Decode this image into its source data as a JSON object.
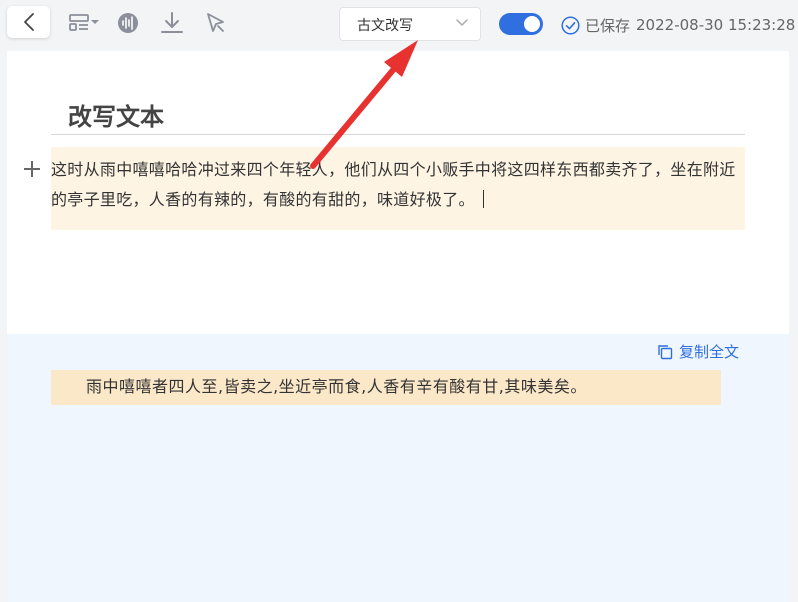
{
  "toolbar": {
    "back_icon": "chevron-left-icon",
    "tools": [
      "layout-menu-icon",
      "audio-wave-icon",
      "download-icon",
      "pointer-cursor-icon"
    ],
    "mode_select": {
      "value": "古文改写"
    },
    "toggle": {
      "on": true
    },
    "saved": {
      "label": "已保存",
      "datetime": "2022-08-30 15:23:28"
    }
  },
  "editor": {
    "title": "改写文本",
    "source_text": "这时从雨中嘻嘻哈哈冲过来四个年轻人，他们从四个小贩手中将这四样东西都卖齐了，坐在附近的亭子里吃，人香的有辣的，有酸的有甜的，味道好极了。"
  },
  "result": {
    "copy_all_label": "复制全文",
    "text": "雨中嘻嘻者四人至,皆卖之,坐近亭而食,人香有辛有酸有甘,其味美矣。"
  },
  "colors": {
    "accent": "#2f6fdf",
    "annotation_arrow": "#e8322f",
    "source_highlight": "#fdf4e4",
    "result_highlight": "#fbe8c9",
    "result_panel": "#f0f6fe"
  }
}
